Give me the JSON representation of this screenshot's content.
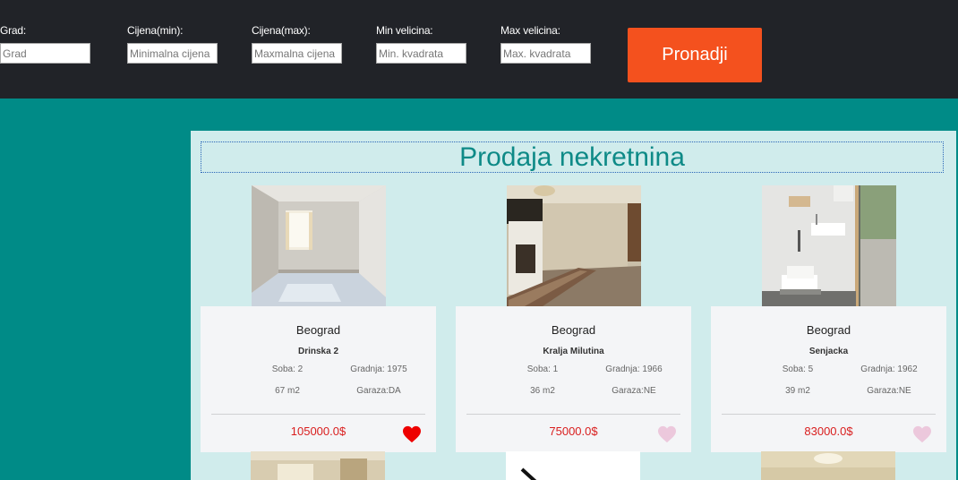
{
  "search": {
    "city": {
      "label": "Grad:",
      "placeholder": "Grad"
    },
    "price_min": {
      "label": "Cijena(min):",
      "placeholder": "Minimalna cijena"
    },
    "price_max": {
      "label": "Cijena(max):",
      "placeholder": "Maxmalna cijena"
    },
    "size_min": {
      "label": "Min velicina:",
      "placeholder": "Min. kvadrata"
    },
    "size_max": {
      "label": "Max velicina:",
      "placeholder": "Max. kvadrata"
    },
    "button_label": "Pronadji"
  },
  "page_title": "Prodaja nekretnina",
  "listings": [
    {
      "city": "Beograd",
      "street": "Drinska 2",
      "rooms": "Soba: 2",
      "built": "Gradnja: 1975",
      "area": "67 m2",
      "garage": "Garaza:DA",
      "price": "105000.0$",
      "favorite": true,
      "heart_icon": "heart-filled-icon"
    },
    {
      "city": "Beograd",
      "street": "Kralja Milutina",
      "rooms": "Soba: 1",
      "built": "Gradnja: 1966",
      "area": "36 m2",
      "garage": "Garaza:NE",
      "price": "75000.0$",
      "favorite": false,
      "heart_icon": "heart-outline-icon"
    },
    {
      "city": "Beograd",
      "street": "Senjacka",
      "rooms": "Soba: 5",
      "built": "Gradnja: 1962",
      "area": "39 m2",
      "garage": "Garaza:NE",
      "price": "83000.0$",
      "favorite": false,
      "heart_icon": "heart-outline-icon"
    }
  ],
  "colors": {
    "topbar": "#212328",
    "background": "#008b87",
    "panel": "#d0ecec",
    "accent_button": "#f4511e",
    "price": "#d91e1e",
    "heart_active": "#ee0000",
    "heart_inactive": "#ecc8dc"
  }
}
